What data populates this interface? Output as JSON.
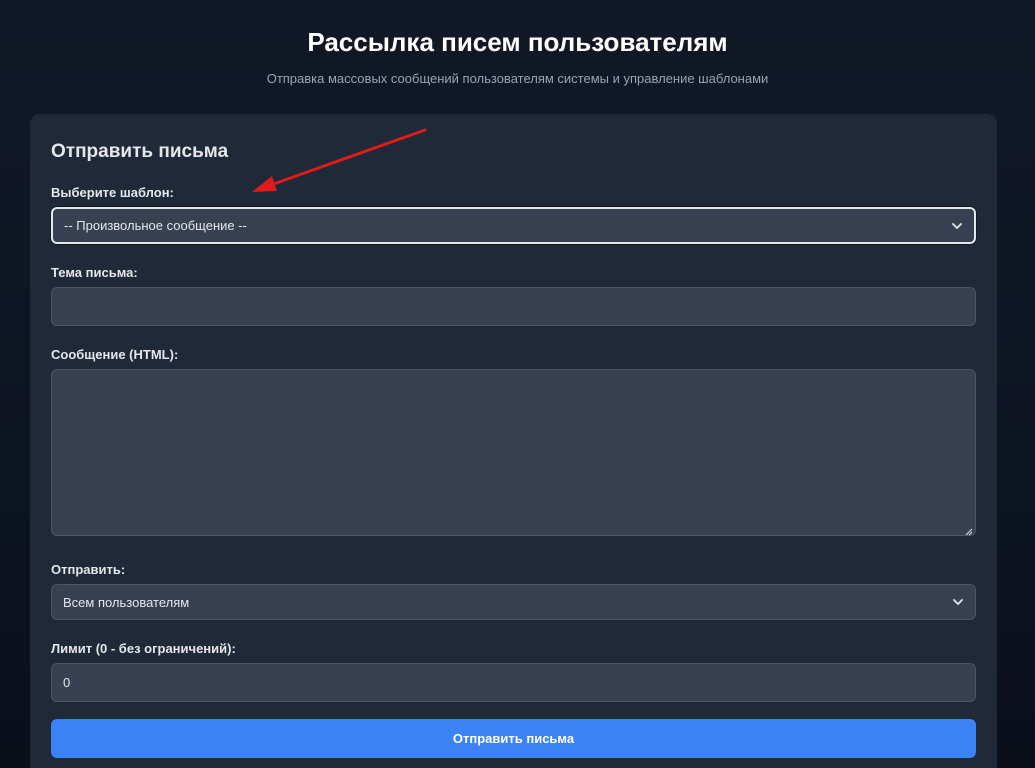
{
  "header": {
    "title": "Рассылка писем пользователям",
    "subtitle": "Отправка массовых сообщений пользователям системы и управление шаблонами"
  },
  "form": {
    "title": "Отправить письма",
    "template": {
      "label": "Выберите шаблон:",
      "value": "-- Произвольное сообщение --"
    },
    "subject": {
      "label": "Тема письма:",
      "value": ""
    },
    "message": {
      "label": "Сообщение (HTML):",
      "value": ""
    },
    "recipients": {
      "label": "Отправить:",
      "value": "Всем пользователям"
    },
    "limit": {
      "label": "Лимит (0 - без ограничений):",
      "value": "0"
    },
    "submit_label": "Отправить письма"
  },
  "icons": {
    "select_chevron": "chevron-down-icon",
    "textarea_resize": "resize-grip-icon",
    "annotation": "red-arrow-icon"
  },
  "colors": {
    "background": "#111827",
    "card": "#1f2937",
    "input": "#374151",
    "accent": "#3b82f6",
    "annotation": "#e01b1b"
  }
}
